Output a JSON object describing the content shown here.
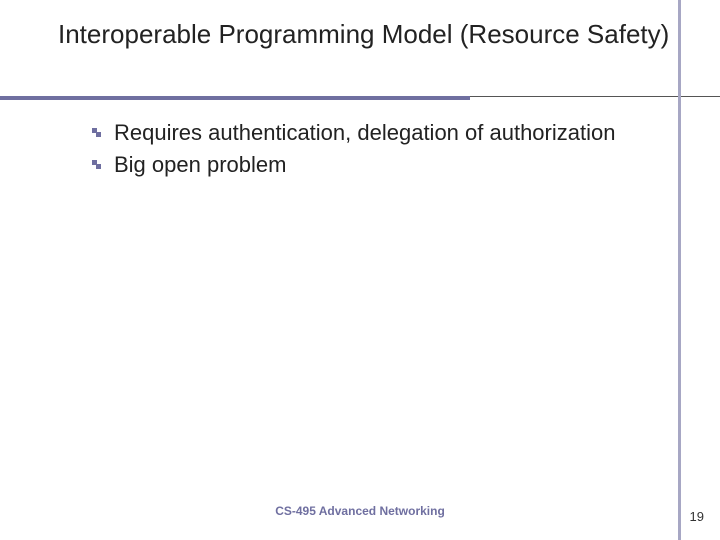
{
  "title": "Interoperable Programming Model (Resource Safety)",
  "bullets": [
    "Requires authentication, delegation of authorization",
    "Big open problem"
  ],
  "footer": "CS-495 Advanced Networking",
  "page": "19"
}
